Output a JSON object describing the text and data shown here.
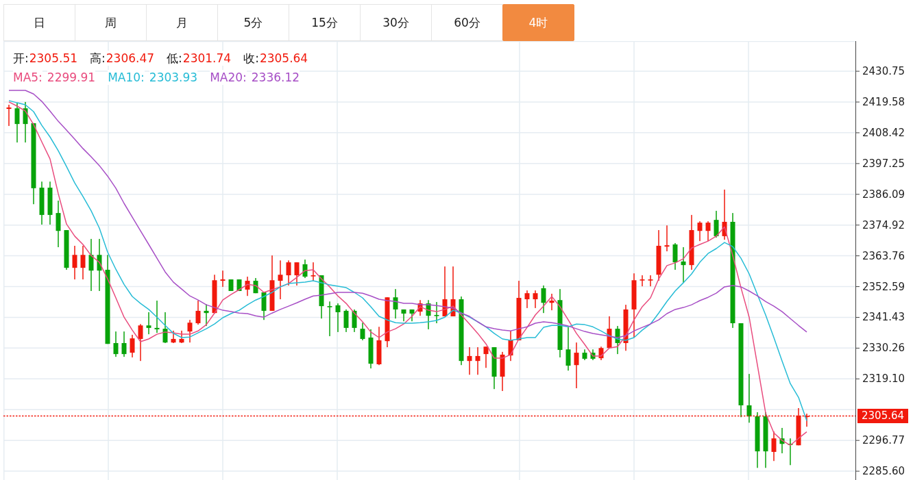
{
  "tabs": [
    {
      "label": "日",
      "selected": false
    },
    {
      "label": "周",
      "selected": false
    },
    {
      "label": "月",
      "selected": false
    },
    {
      "label": "5分",
      "selected": false
    },
    {
      "label": "15分",
      "selected": false
    },
    {
      "label": "30分",
      "selected": false
    },
    {
      "label": "60分",
      "selected": false
    },
    {
      "label": "4时",
      "selected": true
    }
  ],
  "quote": [
    {
      "label": "开:",
      "value": "2305.51"
    },
    {
      "label": "高:",
      "value": "2306.47"
    },
    {
      "label": "低:",
      "value": "2301.74"
    },
    {
      "label": "收:",
      "value": "2305.64"
    }
  ],
  "chart": {
    "legend_readings": [
      "2299.91",
      "2303.93",
      "2336.12"
    ],
    "chart_data": {
      "type": "candlestick",
      "grid": true,
      "ylim": [
        2282.4,
        2441.7
      ],
      "yticks": [
        2430.75,
        2419.58,
        2408.42,
        2397.25,
        2386.09,
        2374.92,
        2363.76,
        2352.59,
        2341.43,
        2330.26,
        {
          "value": 2319.1,
          "label": "2319.10"
        },
        2296.77,
        {
          "value": 2285.6,
          "label": "2285.60"
        }
      ],
      "ohlc": [
        [
          2417.1,
          2418.6,
          2410.9,
          2417.6
        ],
        [
          2417.3,
          2419.3,
          2404.9,
          2411.6
        ],
        [
          2417.3,
          2419.6,
          2404.9,
          2411.6
        ],
        [
          2411.9,
          2411.9,
          2382.5,
          2388.3
        ],
        [
          2388.5,
          2390.7,
          2375.1,
          2378.6
        ],
        [
          2388.5,
          2390.7,
          2375.1,
          2378.6
        ],
        [
          2379.3,
          2383.8,
          2366.9,
          2372.8
        ],
        [
          2373.1,
          2373.1,
          2358.7,
          2359.4
        ],
        [
          2359.4,
          2367.4,
          2355.2,
          2364.1
        ],
        [
          2359.4,
          2367.4,
          2355.2,
          2364.1
        ],
        [
          2364.1,
          2369.9,
          2351.0,
          2358.4
        ],
        [
          2364.1,
          2369.9,
          2351.0,
          2358.4
        ],
        [
          2358.7,
          2364.1,
          2331.8,
          2331.8
        ],
        [
          2332.1,
          2336.3,
          2327.1,
          2328.1
        ],
        [
          2332.1,
          2336.3,
          2327.1,
          2328.1
        ],
        [
          2328.6,
          2335.1,
          2326.9,
          2333.8
        ],
        [
          2333.6,
          2339.0,
          2325.6,
          2338.5
        ],
        [
          2338.5,
          2343.3,
          2335.3,
          2337.6
        ],
        [
          2337.6,
          2347.5,
          2335.8,
          2337.1
        ],
        [
          2337.3,
          2343.3,
          2332.1,
          2332.3
        ],
        [
          2332.3,
          2336.6,
          2332.1,
          2333.6
        ],
        [
          2332.3,
          2336.6,
          2332.1,
          2333.6
        ],
        [
          2336.3,
          2340.5,
          2332.3,
          2339.5
        ],
        [
          2339.3,
          2347.5,
          2338.8,
          2343.8
        ],
        [
          2343.8,
          2346.2,
          2338.3,
          2343.0
        ],
        [
          2343.0,
          2356.9,
          2342.8,
          2354.9
        ],
        [
          2354.7,
          2358.4,
          2352.5,
          2355.2
        ],
        [
          2355.2,
          2355.2,
          2351.0,
          2351.0
        ],
        [
          2355.2,
          2355.2,
          2351.0,
          2351.0
        ],
        [
          2351.5,
          2356.2,
          2349.2,
          2354.7
        ],
        [
          2354.7,
          2355.7,
          2350.2,
          2350.2
        ],
        [
          2350.5,
          2350.5,
          2340.5,
          2343.8
        ],
        [
          2343.8,
          2363.9,
          2343.8,
          2354.9
        ],
        [
          2354.7,
          2362.1,
          2348.0,
          2356.9
        ],
        [
          2356.7,
          2362.1,
          2353.0,
          2361.4
        ],
        [
          2356.7,
          2361.4,
          2353.0,
          2361.4
        ],
        [
          2360.7,
          2362.4,
          2355.7,
          2356.2
        ],
        [
          2356.4,
          2361.4,
          2354.7,
          2356.7
        ],
        [
          2356.7,
          2356.7,
          2341.0,
          2345.5
        ],
        [
          2345.5,
          2347.2,
          2334.6,
          2345.3
        ],
        [
          2345.8,
          2346.5,
          2336.1,
          2343.3
        ],
        [
          2343.8,
          2344.3,
          2336.1,
          2337.6
        ],
        [
          2343.8,
          2344.3,
          2336.1,
          2337.6
        ],
        [
          2337.3,
          2339.5,
          2333.1,
          2333.6
        ],
        [
          2334.1,
          2337.1,
          2322.9,
          2324.6
        ],
        [
          2324.4,
          2338.0,
          2324.1,
          2333.1
        ],
        [
          2332.8,
          2348.7,
          2330.6,
          2348.7
        ],
        [
          2348.7,
          2351.7,
          2341.0,
          2344.3
        ],
        [
          2344.3,
          2344.3,
          2340.0,
          2342.8
        ],
        [
          2344.3,
          2344.3,
          2340.0,
          2342.8
        ],
        [
          2343.5,
          2347.7,
          2342.0,
          2346.5
        ],
        [
          2346.5,
          2347.7,
          2337.1,
          2342.0
        ],
        [
          2342.3,
          2347.0,
          2339.3,
          2342.0
        ],
        [
          2341.8,
          2359.9,
          2341.8,
          2348.0
        ],
        [
          2341.8,
          2359.9,
          2341.8,
          2348.0
        ],
        [
          2348.0,
          2349.0,
          2324.1,
          2325.6
        ],
        [
          2325.6,
          2330.6,
          2320.6,
          2327.4
        ],
        [
          2325.6,
          2330.6,
          2320.6,
          2327.4
        ],
        [
          2328.1,
          2330.8,
          2323.1,
          2330.8
        ],
        [
          2330.6,
          2330.6,
          2315.4,
          2319.9
        ],
        [
          2319.9,
          2328.9,
          2314.7,
          2327.9
        ],
        [
          2327.6,
          2336.6,
          2325.6,
          2333.1
        ],
        [
          2333.1,
          2354.7,
          2333.1,
          2348.5
        ],
        [
          2348.0,
          2351.2,
          2344.8,
          2350.2
        ],
        [
          2348.0,
          2351.2,
          2344.8,
          2350.2
        ],
        [
          2352.0,
          2353.0,
          2343.0,
          2346.7
        ],
        [
          2346.7,
          2350.0,
          2344.0,
          2347.5
        ],
        [
          2347.7,
          2351.7,
          2326.9,
          2329.6
        ],
        [
          2329.8,
          2337.8,
          2322.1,
          2323.9
        ],
        [
          2324.1,
          2332.3,
          2315.7,
          2328.6
        ],
        [
          2328.6,
          2329.8,
          2325.9,
          2326.4
        ],
        [
          2328.6,
          2329.8,
          2325.9,
          2326.4
        ],
        [
          2326.6,
          2330.8,
          2325.9,
          2330.3
        ],
        [
          2330.3,
          2341.8,
          2330.1,
          2337.3
        ],
        [
          2337.3,
          2338.3,
          2328.1,
          2332.1
        ],
        [
          2332.1,
          2346.0,
          2329.3,
          2344.3
        ],
        [
          2344.3,
          2357.4,
          2334.1,
          2354.9
        ],
        [
          2354.9,
          2356.7,
          2352.7,
          2355.2
        ],
        [
          2354.9,
          2356.7,
          2352.7,
          2355.2
        ],
        [
          2356.9,
          2373.1,
          2354.7,
          2367.4
        ],
        [
          2367.1,
          2374.8,
          2365.4,
          2367.6
        ],
        [
          2367.9,
          2368.4,
          2358.7,
          2361.4
        ],
        [
          2361.7,
          2366.9,
          2354.0,
          2360.4
        ],
        [
          2360.4,
          2378.6,
          2358.7,
          2373.1
        ],
        [
          2372.8,
          2376.3,
          2369.1,
          2375.8
        ],
        [
          2372.8,
          2376.3,
          2369.1,
          2375.8
        ],
        [
          2376.8,
          2380.1,
          2370.4,
          2370.9
        ],
        [
          2370.9,
          2387.8,
          2369.6,
          2376.1
        ],
        [
          2376.1,
          2379.3,
          2337.6,
          2339.3
        ],
        [
          2339.3,
          2339.3,
          2305.2,
          2309.5
        ],
        [
          2309.5,
          2320.9,
          2303.2,
          2305.5
        ],
        [
          2305.5,
          2307.0,
          2286.8,
          2292.8
        ],
        [
          2305.5,
          2307.0,
          2286.8,
          2292.8
        ],
        [
          2292.6,
          2300.0,
          2289.3,
          2297.5
        ],
        [
          2297.5,
          2301.3,
          2292.1,
          2295.5
        ],
        [
          2295.5,
          2297.5,
          2287.8,
          2295.3
        ],
        [
          2295.0,
          2308.5,
          2295.0,
          2305.7
        ],
        [
          2305.51,
          2306.47,
          2301.74,
          2305.64
        ]
      ],
      "series": [
        {
          "name": "MA5:",
          "type": "line",
          "color": "#e94c7e",
          "values": [
            2419.6,
            2418.1,
            2416.3,
            2411.4,
            2405.1,
            2398.9,
            2386.3,
            2375.3,
            2370.9,
            2367.9,
            2363.9,
            2361.4,
            2355.4,
            2348.5,
            2341.5,
            2336.8,
            2332.6,
            2333.6,
            2335.3,
            2336.1,
            2335.8,
            2335.3,
            2335.3,
            2336.5,
            2338.8,
            2343.0,
            2347.7,
            2349.7,
            2351.5,
            2353.4,
            2353.0,
            2350.5,
            2351.5,
            2352.5,
            2353.7,
            2355.9,
            2358.4,
            2358.7,
            2355.4,
            2352.5,
            2349.2,
            2346.5,
            2343.0,
            2339.8,
            2336.1,
            2334.1,
            2336.1,
            2337.3,
            2339.0,
            2341.8,
            2345.3,
            2344.0,
            2343.5,
            2344.3,
            2345.5,
            2342.3,
            2339.0,
            2335.6,
            2331.8,
            2326.6,
            2326.6,
            2327.9,
            2333.6,
            2337.8,
            2342.3,
            2345.5,
            2349.0,
            2345.3,
            2340.5,
            2335.6,
            2331.6,
            2327.4,
            2327.4,
            2330.3,
            2330.8,
            2334.8,
            2340.5,
            2345.3,
            2348.5,
            2355.4,
            2360.2,
            2361.2,
            2362.7,
            2366.6,
            2367.9,
            2369.1,
            2370.9,
            2374.3,
            2363.9,
            2352.2,
            2341.5,
            2324.1,
            2306.7,
            2299.5,
            2296.8,
            2295.0,
            2297.5,
            2299.9
          ]
        },
        {
          "name": "MA10:",
          "type": "line",
          "color": "#27bcd6",
          "values": [
            2420.1,
            2419.3,
            2418.6,
            2416.1,
            2411.1,
            2406.9,
            2401.9,
            2396.2,
            2390.2,
            2385.3,
            2380.1,
            2373.8,
            2365.1,
            2358.9,
            2353.4,
            2349.0,
            2346.5,
            2344.3,
            2341.5,
            2338.5,
            2335.6,
            2334.1,
            2334.3,
            2335.8,
            2337.3,
            2339.0,
            2341.3,
            2342.8,
            2344.0,
            2346.0,
            2347.7,
            2349.0,
            2350.5,
            2352.5,
            2353.7,
            2354.0,
            2354.2,
            2354.7,
            2354.0,
            2353.2,
            2352.7,
            2352.2,
            2350.5,
            2348.5,
            2345.3,
            2341.8,
            2340.5,
            2339.5,
            2339.3,
            2339.3,
            2339.5,
            2339.8,
            2340.3,
            2341.5,
            2344.0,
            2343.0,
            2341.5,
            2339.8,
            2338.0,
            2335.6,
            2333.6,
            2333.1,
            2333.6,
            2334.1,
            2334.1,
            2337.8,
            2338.5,
            2338.5,
            2338.0,
            2339.0,
            2338.8,
            2338.0,
            2336.5,
            2334.8,
            2333.6,
            2333.1,
            2334.1,
            2336.8,
            2339.0,
            2343.0,
            2347.2,
            2351.0,
            2354.0,
            2357.2,
            2361.4,
            2364.6,
            2366.4,
            2368.6,
            2367.1,
            2362.9,
            2357.2,
            2349.7,
            2342.3,
            2334.1,
            2325.6,
            2317.4,
            2312.4,
            2303.9
          ]
        },
        {
          "name": "MA20:",
          "type": "line",
          "color": "#a74fc6",
          "values": [
            2423.8,
            2423.8,
            2423.8,
            2422.5,
            2419.8,
            2416.3,
            2412.6,
            2409.4,
            2406.1,
            2402.7,
            2399.7,
            2396.5,
            2392.7,
            2388.3,
            2382.8,
            2377.8,
            2372.8,
            2367.9,
            2362.9,
            2357.9,
            2354.2,
            2351.7,
            2349.2,
            2347.7,
            2346.0,
            2345.0,
            2344.0,
            2343.5,
            2343.0,
            2342.8,
            2342.0,
            2341.5,
            2343.0,
            2344.3,
            2345.5,
            2346.7,
            2348.0,
            2349.2,
            2349.5,
            2350.0,
            2350.5,
            2350.5,
            2350.5,
            2350.2,
            2349.2,
            2348.0,
            2347.5,
            2347.2,
            2346.5,
            2346.5,
            2346.0,
            2346.0,
            2345.7,
            2345.3,
            2344.8,
            2343.0,
            2341.8,
            2339.8,
            2338.0,
            2337.3,
            2336.8,
            2336.5,
            2337.3,
            2338.0,
            2339.3,
            2339.8,
            2339.5,
            2339.0,
            2338.3,
            2337.3,
            2336.3,
            2335.6,
            2335.1,
            2334.6,
            2334.1,
            2334.8,
            2336.5,
            2337.8,
            2339.0,
            2340.5,
            2342.8,
            2344.3,
            2345.0,
            2346.0,
            2347.5,
            2348.7,
            2350.2,
            2352.5,
            2353.0,
            2352.5,
            2351.0,
            2349.2,
            2347.2,
            2345.5,
            2343.5,
            2341.0,
            2338.5,
            2336.1
          ]
        }
      ],
      "ref_lines": [
        {
          "axis": "y",
          "value": 2305.64,
          "label": "2305.64"
        }
      ]
    }
  }
}
